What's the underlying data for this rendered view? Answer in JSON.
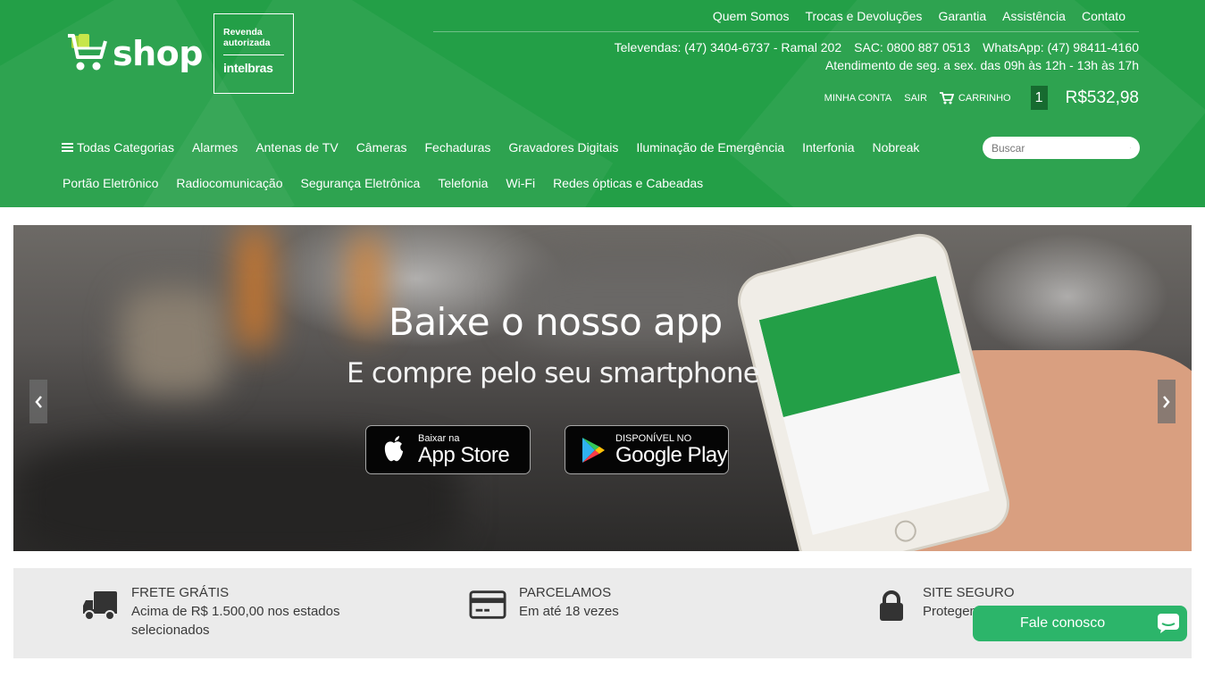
{
  "header": {
    "logo_text": "shop",
    "reseller_line1": "Revenda",
    "reseller_line2": "autorizada",
    "reseller_brand": "intelbras",
    "top_links": [
      "Quem Somos",
      "Trocas e Devoluções",
      "Garantia",
      "Assistência",
      "Contato"
    ],
    "televendas": "Televendas: (47) 3404-6737 - Ramal 202",
    "sac": "SAC: 0800 887 0513",
    "whatsapp": "WhatsApp: (47) 98411-4160",
    "hours": "Atendimento de seg. a sex. das 09h às 12h - 13h às 17h",
    "my_account": "MINHA CONTA",
    "logout": "SAIR",
    "cart_label": "CARRINHO",
    "cart_count": "1",
    "cart_total": "R$532,98",
    "brand_color": "#239f47"
  },
  "nav": {
    "all_categories": "Todas Categorias",
    "row1": [
      "Alarmes",
      "Antenas de TV",
      "Câmeras",
      "Fechaduras",
      "Gravadores Digitais",
      "Iluminação de Emergência",
      "Interfonia",
      "Nobreak"
    ],
    "row2": [
      "Portão Eletrônico",
      "Radiocomunicação",
      "Segurança Eletrônica",
      "Telefonia",
      "Wi-Fi",
      "Redes ópticas e Cabeadas"
    ]
  },
  "search": {
    "placeholder": "Buscar",
    "icon": "search-icon"
  },
  "banner": {
    "title": "Baixe o nosso app",
    "subtitle": "E compre pelo seu smartphone",
    "appstore_small": "Baixar na",
    "appstore_big": "App Store",
    "googleplay_small": "DISPONÍVEL NO",
    "googleplay_big": "Google Play",
    "prev_icon": "chevron-left-icon",
    "next_icon": "chevron-right-icon"
  },
  "features": [
    {
      "icon": "truck-icon",
      "title": "FRETE GRÁTIS",
      "line1": "Acima de R$ 1.500,00 nos estados",
      "line2": "selecionados"
    },
    {
      "icon": "credit-card-icon",
      "title": "PARCELAMOS",
      "line1": "Em até 18 vezes",
      "line2": ""
    },
    {
      "icon": "lock-icon",
      "title": "SITE SEGURO",
      "line1": "Protegem",
      "line2": ""
    }
  ],
  "chat": {
    "label": "Fale conosco",
    "icon": "chat-icon",
    "color": "#2cb56a"
  }
}
